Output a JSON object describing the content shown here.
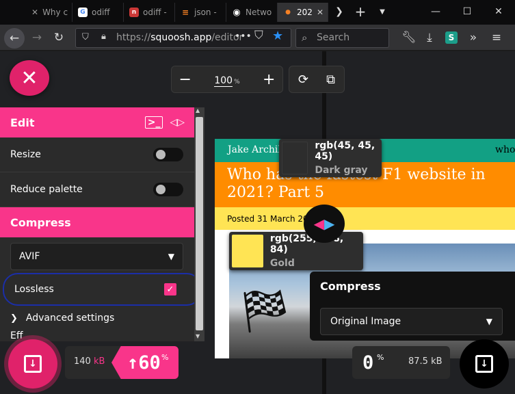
{
  "browser": {
    "tabs": [
      {
        "title": "Why c",
        "icon": "close-tab-icon",
        "color": "#0c0c0d",
        "letter": ""
      },
      {
        "title": "odiff",
        "icon": "google-icon",
        "color": "#ffffff",
        "letter": "G"
      },
      {
        "title": "odiff -",
        "icon": "npm-icon",
        "color": "#cb3837",
        "letter": "n"
      },
      {
        "title": "json -",
        "icon": "stackoverflow-icon",
        "color": "#f48024",
        "letter": "≡"
      },
      {
        "title": "Netwo",
        "icon": "github-icon",
        "color": "#ffffff",
        "letter": "◉"
      },
      {
        "title": "202",
        "icon": "squoosh-icon",
        "color": "#f48024",
        "letter": "●"
      }
    ],
    "url_host": "squoosh.app",
    "url_path": "/editor",
    "search_placeholder": "Search"
  },
  "toolbar": {
    "zoom_value": "100",
    "zoom_unit": "%"
  },
  "edit_panel": {
    "title": "Edit",
    "options": [
      {
        "label": "Resize",
        "enabled": false
      },
      {
        "label": "Reduce palette",
        "enabled": false
      }
    ]
  },
  "compress_panel": {
    "title": "Compress",
    "codec": "AVIF",
    "lossless_label": "Lossless",
    "lossless_checked": true,
    "advanced_label": "Advanced settings",
    "clipped_label": "Eff"
  },
  "preview": {
    "author": "Jake Archib",
    "nav_text": "who",
    "title": "Who has the fastest F1 website in 2021? Part 5",
    "date": "Posted 31 March 202"
  },
  "swatches": [
    {
      "rgb": "rgb(45, 45, 45)",
      "name": "Dark gray",
      "color": "#2d2d2d"
    },
    {
      "rgb": "rgb(255, 228, 84)",
      "name": "Gold",
      "color": "#ffe454"
    }
  ],
  "right_panel": {
    "title": "Compress",
    "select_value": "Original Image"
  },
  "results": {
    "left_size": "140",
    "left_size_unit": "kB",
    "left_percent": "↑60",
    "left_percent_unit": "%",
    "right_percent": "0",
    "right_percent_unit": "%",
    "right_size": "87.5 kB"
  },
  "colors": {
    "accent": "#f9358a",
    "close_button": "#e0226a"
  }
}
